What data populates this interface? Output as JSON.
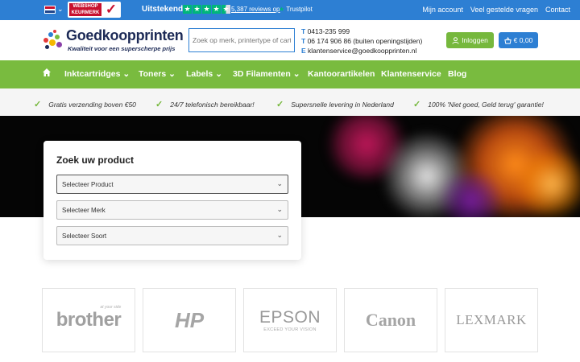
{
  "topbar": {
    "rating_label": "Uitstekend",
    "reviews_text": "5,387 reviews op",
    "trustpilot": "Trustpilot",
    "keurmerk_line1": "WEBSHOP",
    "keurmerk_line2": "KEURMERK",
    "links": [
      "Mijn account",
      "Veel gestelde vragen",
      "Contact"
    ]
  },
  "header": {
    "logo_name": "Goedkoopprinten",
    "logo_tagline": "Kwaliteit voor een superscherpe prijs",
    "search_placeholder": "Zoek op merk, printertype of cart",
    "phone1_label": "T",
    "phone1": "0413-235 999",
    "phone2_label": "T",
    "phone2": "06 174 906 86 (buiten openingstijden)",
    "email_label": "E",
    "email": "klantenservice@goedkoopprinten.nl",
    "login_label": "Inloggen",
    "cart_label": "€ 0,00"
  },
  "nav": {
    "items": [
      "Inktcartridges",
      "Toners",
      "Labels",
      "3D Filamenten",
      "Kantoorartikelen",
      "Klantenservice",
      "Blog"
    ]
  },
  "usps": [
    "Gratis verzending boven €50",
    "24/7 telefonisch bereikbaar!",
    "Supersnelle levering in Nederland",
    "100% 'Niet goed, Geld terug' garantie!"
  ],
  "finder": {
    "title": "Zoek uw product",
    "selects": [
      "Selecteer Product",
      "Selecteer Merk",
      "Selecteer Soort"
    ]
  },
  "brands": [
    "brother",
    "HP",
    "EPSON",
    "Canon",
    "LEXMARK"
  ],
  "brand_sub": {
    "brother": "at your side",
    "epson": "EXCEED YOUR VISION"
  },
  "colors": {
    "blue": "#2d7fd3",
    "green": "#79bb3f",
    "trustpilot_green": "#00b67a"
  },
  "icons": [
    "home-icon",
    "user-icon",
    "cart-icon",
    "check-icon",
    "chevron-down-icon",
    "star-icon"
  ]
}
